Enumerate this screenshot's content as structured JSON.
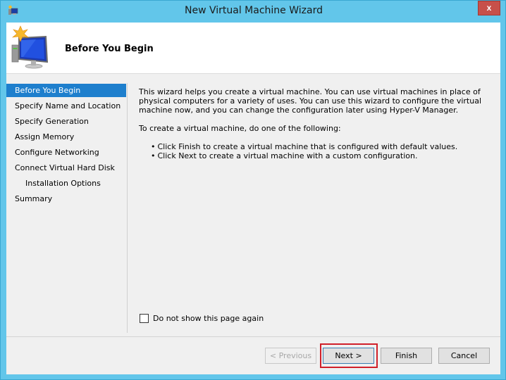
{
  "window": {
    "title": "New Virtual Machine Wizard",
    "close_label": "x"
  },
  "header": {
    "title": "Before You Begin",
    "icon": "new-vm-monitor-icon"
  },
  "nav": {
    "items": [
      {
        "label": "Before You Begin",
        "active": true,
        "indent": false
      },
      {
        "label": "Specify Name and Location",
        "active": false,
        "indent": false
      },
      {
        "label": "Specify Generation",
        "active": false,
        "indent": false
      },
      {
        "label": "Assign Memory",
        "active": false,
        "indent": false
      },
      {
        "label": "Configure Networking",
        "active": false,
        "indent": false
      },
      {
        "label": "Connect Virtual Hard Disk",
        "active": false,
        "indent": false
      },
      {
        "label": "Installation Options",
        "active": false,
        "indent": true
      },
      {
        "label": "Summary",
        "active": false,
        "indent": false
      }
    ]
  },
  "content": {
    "intro": "This wizard helps you create a virtual machine. You can use virtual machines in place of physical computers for a variety of uses. You can use this wizard to configure the virtual machine now, and you can change the configuration later using Hyper-V Manager.",
    "instruction": "To create a virtual machine, do one of the following:",
    "bullets": [
      "Click Finish to create a virtual machine that is configured with default values.",
      "Click Next to create a virtual machine with a custom configuration."
    ]
  },
  "options": {
    "dont_show_label": "Do not show this page again",
    "dont_show_checked": false
  },
  "buttons": {
    "previous": "< Previous",
    "next": "Next >",
    "finish": "Finish",
    "cancel": "Cancel"
  },
  "colors": {
    "frame": "#62c6ea",
    "selection": "#1e7fcd",
    "close": "#c7504a",
    "highlight": "#d0202a"
  }
}
